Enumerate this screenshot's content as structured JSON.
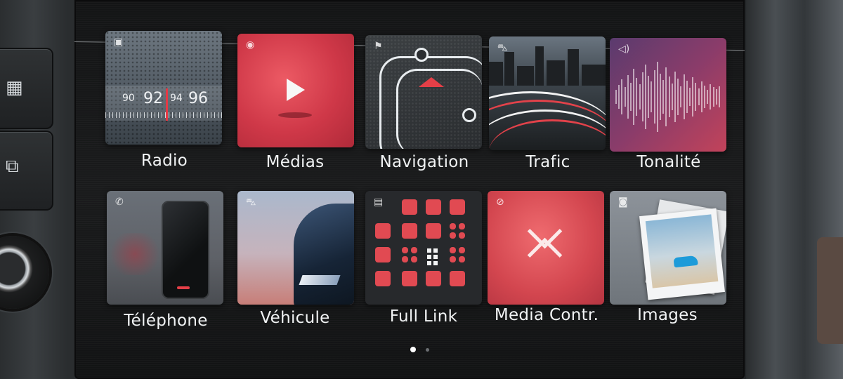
{
  "apps": [
    {
      "label": "Radio",
      "icon": "radio-icon"
    },
    {
      "label": "Médias",
      "icon": "media-play-icon"
    },
    {
      "label": "Navigation",
      "icon": "navigation-icon"
    },
    {
      "label": "Trafic",
      "icon": "traffic-icon"
    },
    {
      "label": "Tonalité",
      "icon": "sound-icon"
    },
    {
      "label": "Téléphone",
      "icon": "phone-icon"
    },
    {
      "label": "Véhicule",
      "icon": "car-icon"
    },
    {
      "label": "Full Link",
      "icon": "full-link-icon"
    },
    {
      "label": "Media Contr.",
      "icon": "media-control-icon"
    },
    {
      "label": "Images",
      "icon": "images-icon"
    }
  ],
  "radio_scale": [
    "90",
    "92",
    "94",
    "96"
  ],
  "pagination": {
    "pages": 2,
    "current": 1
  },
  "colors": {
    "accent": "#e14a52",
    "label": "#f1f3f4",
    "screen_bg": "#161718"
  }
}
